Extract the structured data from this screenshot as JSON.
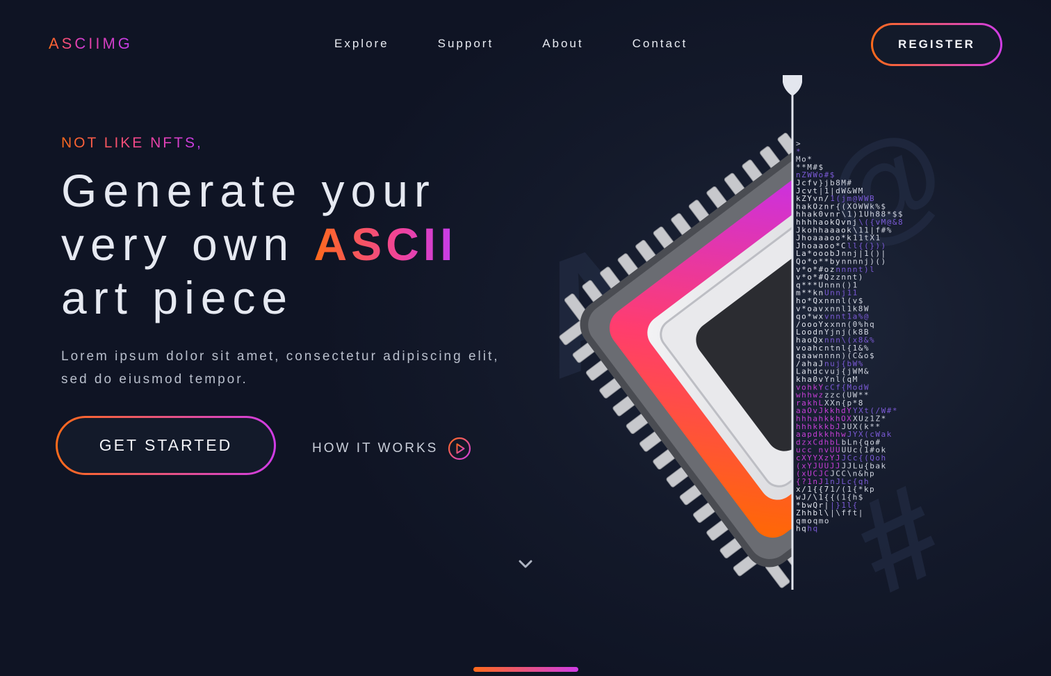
{
  "header": {
    "logo": {
      "part1": "ASC",
      "part2": "IIMG"
    },
    "nav": [
      "Explore",
      "Support",
      "About",
      "Contact"
    ],
    "register_label": "REGISTER"
  },
  "hero": {
    "eyebrow": "NOT LIKE NFTS,",
    "headline_line1": "Generate your",
    "headline_line2_prefix": "very own ",
    "headline_accent": "ASCII",
    "headline_line3": "art piece",
    "description": "Lorem ipsum dolor sit amet, consectetur adipiscing elit, sed do eiusmod tempor.",
    "cta_label": "GET STARTED",
    "how_label": "HOW IT WORKS"
  },
  "icons": {
    "play": "play-circle-icon",
    "scroll": "chevron-down-icon",
    "chip": "cpu-chip-illustration"
  },
  "colors": {
    "background": "#131a2a",
    "accent_start": "#ff6a1a",
    "accent_end": "#d03ce6",
    "text": "#e6e9f1"
  },
  "ascii_lines": [
    ">",
    "*",
    "Mo*",
    "**M#$",
    "nZWWo#$",
    "}jb8M#",
    "|1|dW&WM",
    "1(jm@WWB",
    "{(XOWWk%$",
    "\\1)1Uh88*$$",
    "\\({vM@&8",
    "\\11|f#%",
    "11tX1",
    "ll{(}))",
    "nnj|1()|",
    "nnnnj)()",
    "nnnnt)l",
    "zznnt)",
    "nnn()1",
    "Unnj11",
    "nnnl(v$",
    "xnnl1k8W",
    "vnnt1a%@",
    "xnn(0%hq",
    "Yjnj(k8B",
    "nnn\\(x8&%",
    "ntnl{1&%",
    "nnn)(C&o$",
    "nuj{bW%",
    "vuj{jWM&",
    "Ynl(qM",
    "cCf{ModW",
    "zzc(UW**",
    "XXn{p*8",
    "YXt(/W#*",
    "XUz1Z*",
    "JUX(k**",
    "JYX(cWak",
    "bLn{qo#",
    "UUc(1#ok",
    "JCc{(Qoh",
    "JJLu{bak",
    "JCC\\n&hp",
    "1nJLc{qh",
    "1/(1{*kp",
    "{(1{h$",
    "|}1l{",
    "|\\fft|",
    "qmo",
    "hq"
  ],
  "ascii_left": [
    "",
    "",
    "",
    "",
    "",
    "Jcfv",
    "Jcvt",
    "kZYvn/",
    "hakOznr",
    "hhak0vnr",
    "hhhhaokQvnj",
    "Jkohhaaaok",
    "Jhoaaaoo*k",
    "Jhoaaoo*C",
    "La*ooobJ",
    "Qo*o**by",
    "v*o*#oz",
    "v*o*#Q",
    "q***U",
    "m**kn",
    "ho*Qx",
    "v*oav",
    "qo*wx",
    "/oooYx",
    "Loodn",
    "haoQx",
    "voahc",
    "qaawn",
    "/ahaJ",
    "Lahdc",
    "kha0v",
    "vohkY",
    "whhwz",
    "rakhL",
    "aaOvJkkhdY",
    "hhhahkkhOX",
    "hhhkkkbJ",
    "aapdkkhhw",
    "dzxCdhbL",
    "ucc nvUU",
    "cXYYXzYJ",
    "(xYJUUJJ",
    "(xUCJC",
    "{?1nJ",
    "x/1{{7",
    "wJ/\\1{",
    "*bwQr|",
    "Zhhbl\\",
    "qmo",
    "hq"
  ]
}
